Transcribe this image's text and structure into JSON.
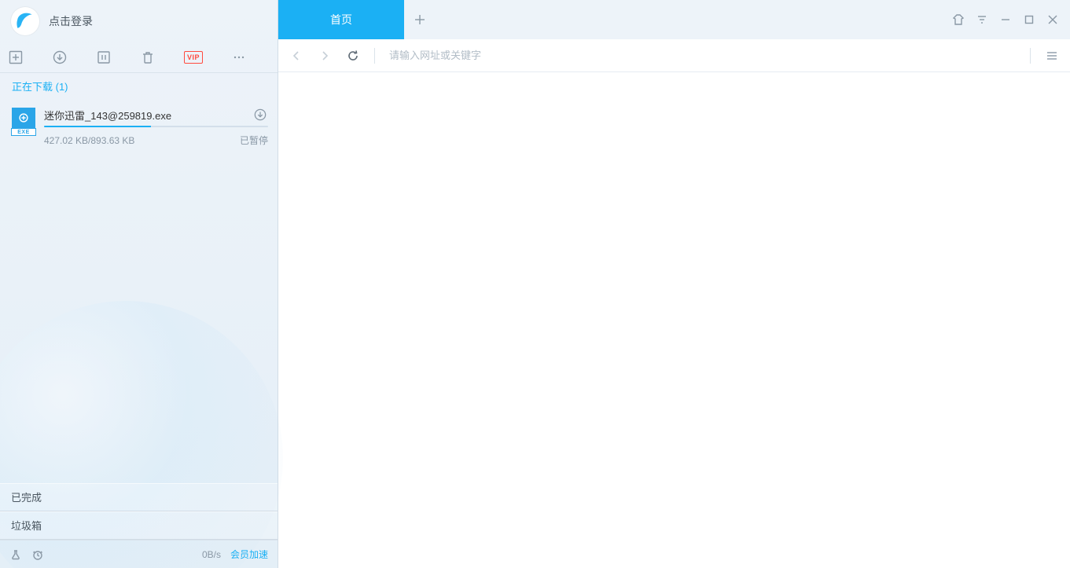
{
  "login": {
    "label": "点击登录"
  },
  "toolbar": {
    "vip_label": "VIP"
  },
  "downloading": {
    "title_tpl": "正在下载 (1)",
    "count": 1,
    "items": [
      {
        "name": "迷你迅雷_143@259819.exe",
        "ext_label": "EXE",
        "downloaded_kb": 427.02,
        "total_kb": 893.63,
        "size_text": "427.02 KB/893.63 KB",
        "status": "已暂停",
        "progress_pct": 47.8
      }
    ]
  },
  "bottom": {
    "completed": "已完成",
    "trash": "垃圾箱",
    "speed": "0B/s",
    "vip_speed": "会员加速"
  },
  "tabs": {
    "home": "首页"
  },
  "nav": {
    "placeholder": "请输入网址或关键字"
  }
}
